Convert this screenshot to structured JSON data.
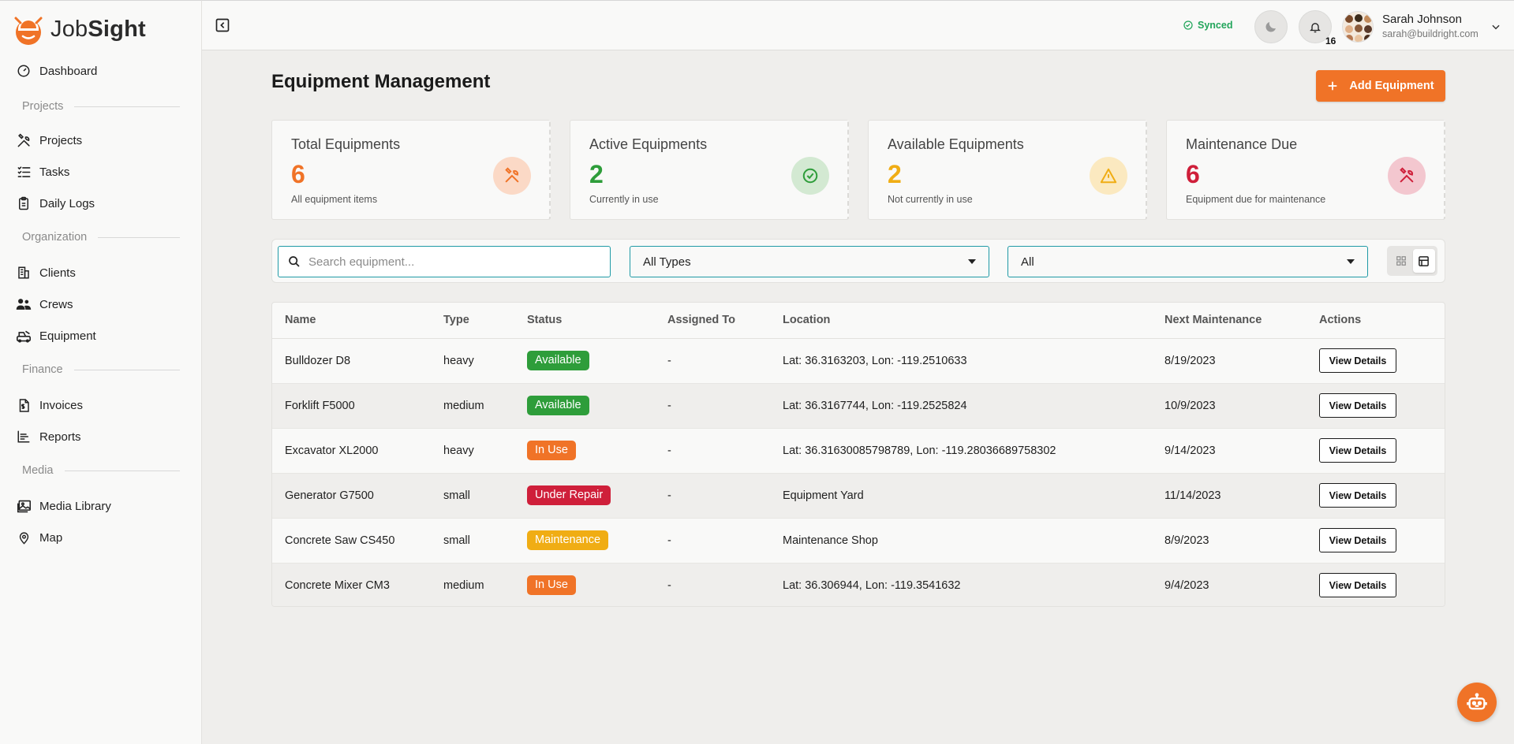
{
  "app": {
    "logo_text_light": "Job",
    "logo_text_bold": "Sight",
    "brand_color": "#f07327"
  },
  "sidebar": {
    "items": [
      {
        "label": "Dashboard",
        "icon": "dashboard-gauge-icon"
      },
      {
        "label": "Projects",
        "icon": "tools-icon"
      },
      {
        "label": "Tasks",
        "icon": "checklist-icon"
      },
      {
        "label": "Daily Logs",
        "icon": "clipboard-icon"
      },
      {
        "label": "Clients",
        "icon": "building-icon"
      },
      {
        "label": "Crews",
        "icon": "users-icon"
      },
      {
        "label": "Equipment",
        "icon": "equipment-icon"
      },
      {
        "label": "Invoices",
        "icon": "invoice-icon"
      },
      {
        "label": "Reports",
        "icon": "chart-icon"
      },
      {
        "label": "Media Library",
        "icon": "image-icon"
      },
      {
        "label": "Map",
        "icon": "map-pin-icon"
      }
    ],
    "sections": [
      "Projects",
      "Organization",
      "Finance",
      "Media"
    ]
  },
  "topbar": {
    "sync_status": "Synced",
    "notification_count": "16",
    "user_name": "Sarah Johnson",
    "user_email": "sarah@buildright.com"
  },
  "page": {
    "title": "Equipment Management",
    "add_button": "Add Equipment"
  },
  "stats": [
    {
      "title": "Total Equipments",
      "value": "6",
      "sub": "All equipment items",
      "color": "#f07327",
      "icon": "tools-icon"
    },
    {
      "title": "Active Equipments",
      "value": "2",
      "sub": "Currently in use",
      "color": "#2e9d3a",
      "icon": "check-circle-icon"
    },
    {
      "title": "Available Equipments",
      "value": "2",
      "sub": "Not currently in use",
      "color": "#f0ad14",
      "icon": "warning-icon"
    },
    {
      "title": "Maintenance Due",
      "value": "6",
      "sub": "Equipment due for maintenance",
      "color": "#cf1f3a",
      "icon": "tools-icon"
    }
  ],
  "filters": {
    "search_placeholder": "Search equipment...",
    "type_value": "All Types",
    "status_value": "All"
  },
  "table": {
    "headers": [
      "Name",
      "Type",
      "Status",
      "Assigned To",
      "Location",
      "Next Maintenance",
      "Actions"
    ],
    "action_label": "View Details",
    "rows": [
      {
        "name": "Bulldozer D8",
        "type": "heavy",
        "status": "Available",
        "status_color": "#2e9d3a",
        "assigned": "-",
        "location": "Lat: 36.3163203, Lon: -119.2510633",
        "next": "8/19/2023"
      },
      {
        "name": "Forklift F5000",
        "type": "medium",
        "status": "Available",
        "status_color": "#2e9d3a",
        "assigned": "-",
        "location": "Lat: 36.3167744, Lon: -119.2525824",
        "next": "10/9/2023"
      },
      {
        "name": "Excavator XL2000",
        "type": "heavy",
        "status": "In Use",
        "status_color": "#f07327",
        "assigned": "-",
        "location": "Lat: 36.31630085798789, Lon: -119.28036689758302",
        "next": "9/14/2023"
      },
      {
        "name": "Generator G7500",
        "type": "small",
        "status": "Under Repair",
        "status_color": "#cf1f3a",
        "assigned": "-",
        "location": "Equipment Yard",
        "next": "11/14/2023"
      },
      {
        "name": "Concrete Saw CS450",
        "type": "small",
        "status": "Maintenance",
        "status_color": "#f0ad14",
        "assigned": "-",
        "location": "Maintenance Shop",
        "next": "8/9/2023"
      },
      {
        "name": "Concrete Mixer CM3",
        "type": "medium",
        "status": "In Use",
        "status_color": "#f07327",
        "assigned": "-",
        "location": "Lat: 36.306944, Lon: -119.3541632",
        "next": "9/4/2023"
      }
    ]
  }
}
